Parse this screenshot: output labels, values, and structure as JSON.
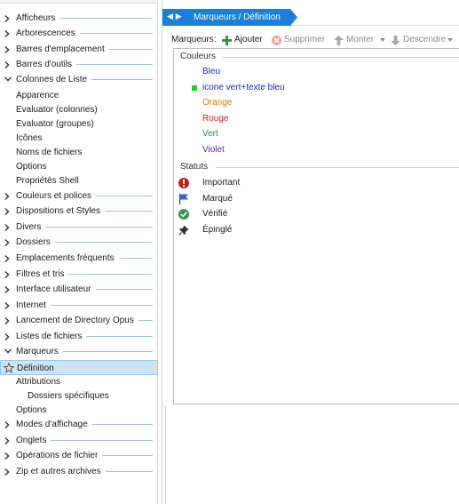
{
  "tree": {
    "items": [
      {
        "label": "Afficheurs",
        "kind": "cat",
        "chev": "right"
      },
      {
        "label": "Arborescences",
        "kind": "cat",
        "chev": "right"
      },
      {
        "label": "Barres d'emplacement",
        "kind": "cat",
        "chev": "right"
      },
      {
        "label": "Barres d'outils",
        "kind": "cat",
        "chev": "right"
      },
      {
        "label": "Colonnes de Liste",
        "kind": "cat",
        "chev": "down"
      },
      {
        "label": "Apparence",
        "kind": "l2"
      },
      {
        "label": "Evaluator (colonnes)",
        "kind": "l2"
      },
      {
        "label": "Evaluator (groupes)",
        "kind": "l2"
      },
      {
        "label": "Icônes",
        "kind": "l2"
      },
      {
        "label": "Noms de fichiers",
        "kind": "l2"
      },
      {
        "label": "Options",
        "kind": "l2"
      },
      {
        "label": "Propriétés Shell",
        "kind": "l2"
      },
      {
        "label": "Couleurs et polices",
        "kind": "cat",
        "chev": "right"
      },
      {
        "label": "Dispositions et Styles",
        "kind": "cat",
        "chev": "right"
      },
      {
        "label": "Divers",
        "kind": "cat",
        "chev": "right"
      },
      {
        "label": "Dossiers",
        "kind": "cat",
        "chev": "right"
      },
      {
        "label": "Emplacements fréquents",
        "kind": "cat",
        "chev": "right"
      },
      {
        "label": "Filtres et tris",
        "kind": "cat",
        "chev": "right"
      },
      {
        "label": "Interface utilisateur",
        "kind": "cat",
        "chev": "right"
      },
      {
        "label": "Internet",
        "kind": "cat",
        "chev": "right"
      },
      {
        "label": "Lancement de Directory Opus",
        "kind": "cat",
        "chev": "right"
      },
      {
        "label": "Listes de fichiers",
        "kind": "cat",
        "chev": "right"
      },
      {
        "label": "Marqueurs",
        "kind": "cat",
        "chev": "down"
      },
      {
        "label": "Définition",
        "kind": "l2",
        "selected": true,
        "icon": "star-icon"
      },
      {
        "label": "Attributions",
        "kind": "l2"
      },
      {
        "label": "Dossiers spécifiques",
        "kind": "l3"
      },
      {
        "label": "Options",
        "kind": "l2"
      },
      {
        "label": "Modes d'affichage",
        "kind": "cat",
        "chev": "right"
      },
      {
        "label": "Onglets",
        "kind": "cat",
        "chev": "right"
      },
      {
        "label": "Opérations de fichier",
        "kind": "cat",
        "chev": "right"
      },
      {
        "label": "Zip et autres archives",
        "kind": "cat",
        "chev": "right"
      }
    ]
  },
  "breadcrumb": {
    "text": "Marqueurs / Définition",
    "back_icon": "arrow-left-icon",
    "forward_icon": "arrow-right-icon"
  },
  "toolbar": {
    "label": "Marqueurs:",
    "add": "Ajouter",
    "delete": "Supprimer",
    "up": "Monter",
    "down": "Descendre"
  },
  "colors_group": {
    "title": "Couleurs",
    "items": [
      {
        "label": "Bleu",
        "color": "#1f1fa6"
      },
      {
        "label": "icone vert+texte bleu",
        "color": "#1f1fa6",
        "swatch": "#22cc22"
      },
      {
        "label": "Orange",
        "color": "#e07000"
      },
      {
        "label": "Rouge",
        "color": "#c02020"
      },
      {
        "label": "Vert",
        "color": "#1f8a3a"
      },
      {
        "label": "Violet",
        "color": "#5a2a9a"
      }
    ]
  },
  "status_group": {
    "title": "Statuts",
    "items": [
      {
        "label": "Important",
        "icon": "exclamation-icon"
      },
      {
        "label": "Marqué",
        "icon": "flag-icon"
      },
      {
        "label": "Vérifié",
        "icon": "check-circle-icon"
      },
      {
        "label": "Épinglé",
        "icon": "pin-icon"
      }
    ]
  },
  "accent": "#1a7fd8"
}
